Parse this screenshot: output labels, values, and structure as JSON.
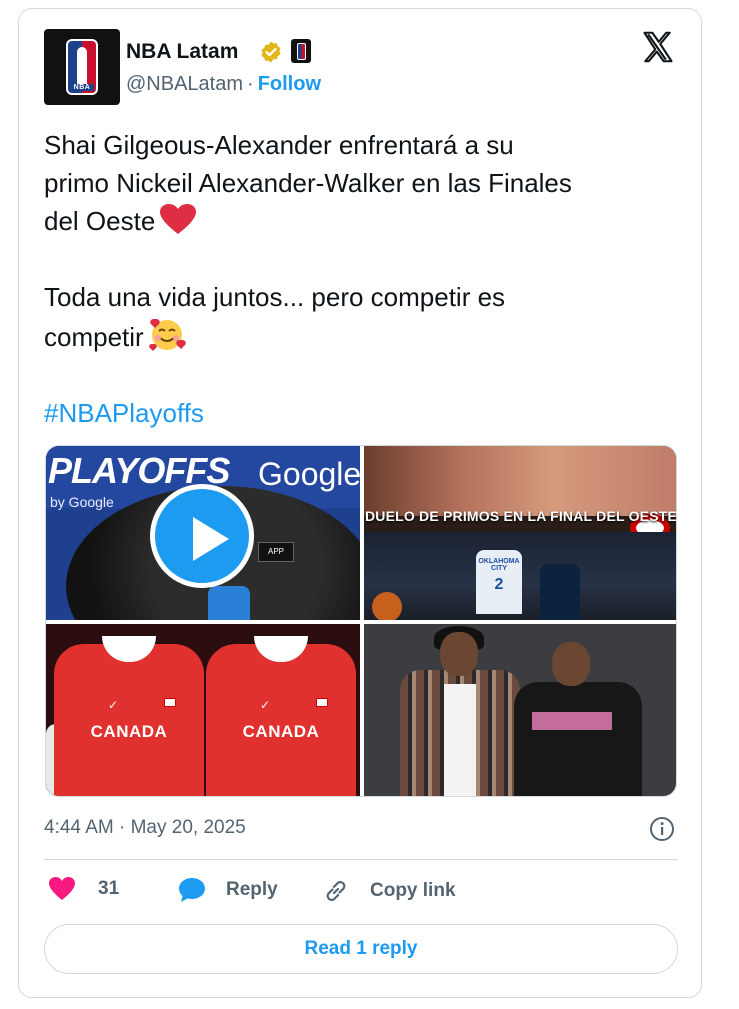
{
  "author": {
    "name": "NBA Latam",
    "handle": "@NBALatam",
    "separator": "·",
    "follow_label": "Follow",
    "avatar_logo_text": "NBA"
  },
  "tweet": {
    "line1": "Shai Gilgeous-Alexander enfrentará a su",
    "line2": "primo Nickeil Alexander-Walker en las Finales",
    "line3": "del Oeste",
    "line4": "Toda una vida juntos... pero competir es",
    "line5": "competir",
    "hashtag": "#NBAPlayoffs",
    "emoji1": "red-heart",
    "emoji2": "smiling-face-with-hearts"
  },
  "media": {
    "tile1": {
      "playoffs_text": "PLAYOFFS",
      "sponsor_text": "Google",
      "sponsor_small": "by Google",
      "mic_label": "APP"
    },
    "tile2": {
      "banner_text": "DUELO DE PRIMOS EN LA FINAL DEL OESTE",
      "jersey_text": "OKLAHOMA CITY",
      "jersey_number": "2"
    },
    "tile3": {
      "shirt_text_left": "CANADA",
      "shirt_text_right": "CANADA"
    }
  },
  "meta": {
    "time": "4:44 AM",
    "separator": "·",
    "date": "May 20, 2025"
  },
  "actions": {
    "like_count": "31",
    "reply_label": "Reply",
    "copy_label": "Copy link"
  },
  "read_button": "Read 1 reply",
  "colors": {
    "accent": "#1d9bf0",
    "like": "#f91880",
    "text": "#0f1419",
    "muted": "#536471",
    "border": "#cfd9de",
    "verified": "#e2b719"
  }
}
